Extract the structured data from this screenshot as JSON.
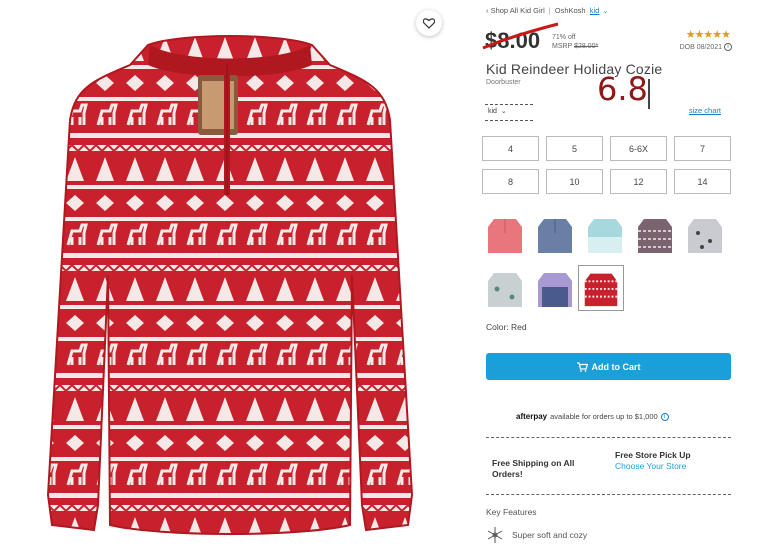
{
  "breadcrumb": {
    "back": "‹ Shop All Kid Girl",
    "sep": "|",
    "brand": "OshKosh",
    "segment": "kid",
    "chevron": "⌄"
  },
  "price": {
    "current": "$8.00",
    "pct_off": "71% off",
    "msrp_label": "MSRP",
    "msrp_value": "$28.00*"
  },
  "rating": {
    "stars": "★★★★★",
    "dob": "DOB 08/2021",
    "info": "i"
  },
  "product": {
    "title": "Kid Reindeer Holiday Cozie",
    "subtitle": "Doorbuster"
  },
  "annotation": {
    "handwritten": "6.8"
  },
  "size_selector": {
    "value": "kid",
    "chevron": "⌄",
    "size_chart": "size chart"
  },
  "sizes": [
    "4",
    "5",
    "6-6X",
    "7",
    "8",
    "10",
    "12",
    "14"
  ],
  "swatches": [
    {
      "name": "pink",
      "color": "#e8767c"
    },
    {
      "name": "navy",
      "color": "#6a7fa6"
    },
    {
      "name": "aqua",
      "color": "#a6d9de"
    },
    {
      "name": "fairisle-purple",
      "color": "#7a6470"
    },
    {
      "name": "grey-print",
      "color": "#c9cbd0"
    },
    {
      "name": "dino-print",
      "color": "#c8d0d2"
    },
    {
      "name": "lavender-navy",
      "color": "#a89ad0"
    },
    {
      "name": "red-reindeer",
      "color": "#c8202c"
    }
  ],
  "color_label": "Color: Red",
  "cart": {
    "label": "Add to Cart",
    "icon": "cart-icon",
    "color": "#1a9fd9"
  },
  "afterpay": {
    "logo": "afterpay",
    "text": "available for orders up to $1,000",
    "info": "i"
  },
  "shipping": {
    "label": "Free Shipping on All Orders!"
  },
  "pickup": {
    "label": "Free Store Pick Up",
    "link": "Choose Your Store"
  },
  "features": {
    "heading": "Key Features",
    "items": [
      "Super soft and cozy"
    ]
  },
  "colors": {
    "accent": "#1a9fd9",
    "sweater_red": "#c8202c",
    "stars": "#e39a1c"
  }
}
